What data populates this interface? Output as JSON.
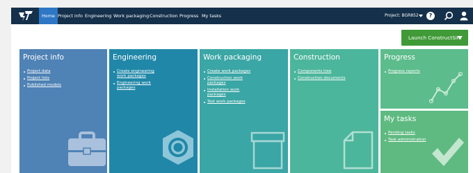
{
  "nav": {
    "items": [
      {
        "label": "Home",
        "active": true
      },
      {
        "label": "Project info"
      },
      {
        "label": "Engineering"
      },
      {
        "label": "Work packaging"
      },
      {
        "label": "Construction"
      },
      {
        "label": "Progress"
      },
      {
        "label": "My tasks"
      }
    ],
    "project_label": "Project: BGR852",
    "help_label": "?",
    "icons": [
      "logo-icon",
      "caret-down-icon",
      "help-icon",
      "search-icon",
      "user-icon"
    ]
  },
  "launch": {
    "label": "Launch ConstructSim"
  },
  "tiles": {
    "project_info": {
      "title": "Project info",
      "links": [
        "Project data",
        "Project lists",
        "Published models"
      ],
      "color": "#4f82b5"
    },
    "engineering": {
      "title": "Engineering",
      "links": [
        "Create engineering work packages",
        "Engineering work packages"
      ],
      "color": "#2087a8"
    },
    "work_packaging": {
      "title": "Work packaging",
      "links": [
        "Create work packages",
        "Construction work packages",
        "Installation work packages",
        "Test work packages"
      ],
      "color": "#3aa6a5"
    },
    "construction": {
      "title": "Construction",
      "links": [
        "Components tree",
        "Construction documents"
      ],
      "color": "#4cb69c"
    },
    "progress": {
      "title": "Progress",
      "links": [
        "Progress reports"
      ],
      "color": "#5cbc8b"
    },
    "my_tasks": {
      "title": "My tasks",
      "links": [
        "Pending tasks",
        "Task administration"
      ],
      "color": "#5fba81"
    }
  }
}
